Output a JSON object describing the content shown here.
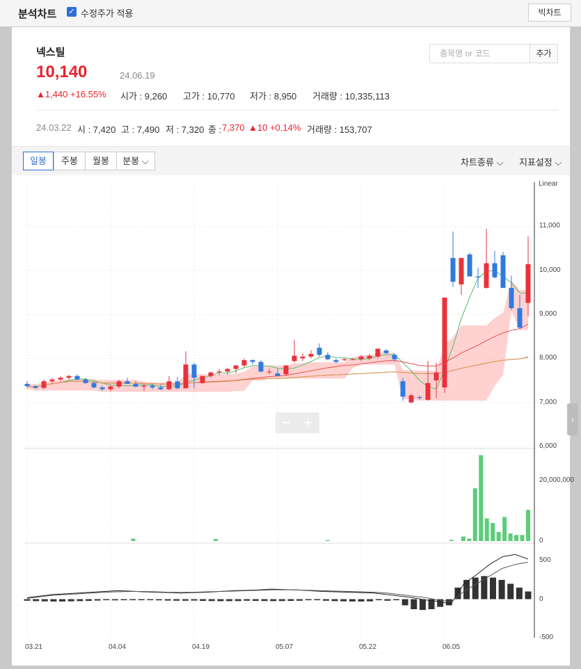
{
  "header": {
    "title": "분석차트",
    "adjusted_price_label": "수정주가 적용",
    "adjusted_price_checked": true,
    "big_chart_button": "빅차트"
  },
  "stock": {
    "name": "넥스틸",
    "price": "10,140",
    "date": "24.06.19",
    "change": "▲1,440 +16.55%",
    "open": "시가 : 9,260",
    "high": "고가 : 10,770",
    "low": "저가 : 8,950",
    "volume": "거래량 : 10,335,113"
  },
  "search": {
    "placeholder": "종목명 or 코드",
    "add_button": "추가"
  },
  "prev_day": {
    "date": "24.03.22",
    "open": "시 : 7,420",
    "high": "고 : 7,490",
    "low": "저 : 7,320",
    "close_label": "종 :",
    "close_value": "7,370",
    "change": "▲10 +0.14%",
    "volume": "거래량 : 153,707"
  },
  "toolbar": {
    "tabs": [
      "일봉",
      "주봉",
      "월봉",
      "분봉"
    ],
    "active_tab": "일봉",
    "chart_type": "차트종류",
    "indicator_settings": "지표설정"
  },
  "colors": {
    "up": "#e8323c",
    "down": "#2f7ae0",
    "volume": "#5dcc7a",
    "cloud": "#ff7b7b"
  },
  "chart_data": {
    "type": "candlestick",
    "scale_label": "Linear",
    "price_axis": {
      "ticks": [
        6000,
        7000,
        8000,
        9000,
        10000,
        11000
      ],
      "labels": [
        "6,000",
        "7,000",
        "8,000",
        "9,000",
        "10,000",
        "11,000"
      ],
      "ylim": [
        6000,
        12000
      ]
    },
    "volume_axis": {
      "ticks": [
        0,
        20000000
      ],
      "labels": [
        "0",
        "20,000,000"
      ],
      "ylim": [
        0,
        30000000
      ]
    },
    "macd_axis": {
      "ticks": [
        -500,
        0,
        500
      ],
      "labels": [
        "-500",
        "0",
        "500"
      ],
      "ylim": [
        -500,
        700
      ]
    },
    "x_labels": [
      "03.21",
      "04.04",
      "04.19",
      "05.07",
      "05.22",
      "06.05"
    ],
    "x_label_index": [
      0,
      10,
      20,
      30,
      40,
      50
    ],
    "candles": [
      [
        7420,
        7490,
        7320,
        7370
      ],
      [
        7370,
        7400,
        7300,
        7330
      ],
      [
        7330,
        7520,
        7300,
        7480
      ],
      [
        7480,
        7560,
        7440,
        7520
      ],
      [
        7520,
        7600,
        7480,
        7560
      ],
      [
        7560,
        7620,
        7520,
        7600
      ],
      [
        7600,
        7640,
        7500,
        7520
      ],
      [
        7520,
        7560,
        7420,
        7440
      ],
      [
        7440,
        7480,
        7320,
        7340
      ],
      [
        7340,
        7380,
        7260,
        7300
      ],
      [
        7300,
        7400,
        7260,
        7360
      ],
      [
        7360,
        7520,
        7320,
        7480
      ],
      [
        7480,
        7560,
        7420,
        7420
      ],
      [
        7420,
        7480,
        7340,
        7360
      ],
      [
        7360,
        7420,
        7260,
        7380
      ],
      [
        7380,
        7420,
        7300,
        7340
      ],
      [
        7340,
        7400,
        7280,
        7300
      ],
      [
        7300,
        7600,
        7280,
        7480
      ],
      [
        7480,
        7580,
        7300,
        7320
      ],
      [
        7320,
        8160,
        7320,
        7860
      ],
      [
        7860,
        7900,
        7320,
        7560
      ],
      [
        7440,
        7600,
        7420,
        7600
      ],
      [
        7600,
        7700,
        7560,
        7680
      ],
      [
        7680,
        7760,
        7620,
        7700
      ],
      [
        7700,
        7780,
        7640,
        7760
      ],
      [
        7760,
        7820,
        7660,
        7840
      ],
      [
        7840,
        8000,
        7800,
        7960
      ],
      [
        7960,
        7980,
        7860,
        7920
      ],
      [
        7920,
        7960,
        7680,
        7700
      ],
      [
        7700,
        7760,
        7640,
        7700
      ],
      [
        7660,
        7760,
        7600,
        7600
      ],
      [
        7640,
        7840,
        7600,
        7840
      ],
      [
        7940,
        8420,
        7900,
        8060
      ],
      [
        8000,
        8120,
        7940,
        8040
      ],
      [
        8040,
        8180,
        8000,
        8100
      ],
      [
        8240,
        8340,
        8040,
        8080
      ],
      [
        8080,
        8140,
        7960,
        7980
      ],
      [
        7960,
        8000,
        7900,
        7920
      ],
      [
        7960,
        8000,
        7940,
        7980
      ],
      [
        7980,
        8000,
        7960,
        7980
      ],
      [
        7980,
        8080,
        7940,
        8040
      ],
      [
        8000,
        8100,
        7960,
        8060
      ],
      [
        8040,
        8220,
        8000,
        8220
      ],
      [
        8180,
        8200,
        8100,
        8120
      ],
      [
        8080,
        8120,
        7920,
        7980
      ],
      [
        7480,
        7560,
        7040,
        7130
      ],
      [
        7000,
        7200,
        6980,
        7160
      ],
      [
        7120,
        7160,
        7060,
        7100
      ],
      [
        7060,
        7940,
        7040,
        7440
      ],
      [
        7500,
        7900,
        7100,
        7680
      ],
      [
        7340,
        9380,
        7220,
        9380
      ],
      [
        10280,
        10880,
        9620,
        9740
      ],
      [
        9680,
        10280,
        9440,
        10280
      ],
      [
        10360,
        10400,
        9880,
        9860
      ],
      [
        9860,
        10060,
        9600,
        9840
      ],
      [
        9600,
        10940,
        9580,
        10160
      ],
      [
        10160,
        10440,
        9820,
        9840
      ],
      [
        10340,
        10420,
        9760,
        9600
      ],
      [
        9600,
        9880,
        9100,
        9140
      ],
      [
        9140,
        9440,
        8660,
        8700
      ],
      [
        9260,
        10770,
        8950,
        10140
      ]
    ],
    "volume": [
      0,
      0,
      0,
      0,
      0,
      0,
      0,
      0,
      0,
      0,
      0,
      0,
      0,
      0,
      0,
      0,
      0,
      0,
      800000,
      0,
      0,
      0,
      0,
      0,
      0,
      0,
      0,
      0,
      0,
      0,
      0,
      0,
      700000,
      0,
      0,
      0,
      0,
      0,
      0,
      0,
      0,
      0,
      0,
      0,
      0,
      0,
      0,
      0,
      0,
      0,
      0,
      300000,
      0,
      0,
      0,
      0,
      0,
      0,
      0,
      0,
      0,
      0,
      0,
      0,
      0,
      0,
      0,
      0,
      0,
      0,
      0,
      0,
      400000,
      0,
      1500000,
      800000,
      17500000,
      28500000,
      7500000,
      6000000,
      3000000,
      8000000,
      2500000,
      2000000,
      2000000,
      10335113
    ],
    "macd_hist": [
      -20,
      -25,
      -28,
      -30,
      -30,
      -28,
      -25,
      -22,
      -18,
      0,
      -15,
      -12,
      -10,
      -8,
      -12,
      -15,
      -18,
      -20,
      -20,
      -18,
      -22,
      -24,
      -26,
      -25,
      -24,
      -20,
      -22,
      -24,
      -25,
      -24,
      -22,
      -20,
      -10,
      -8,
      -20,
      -25,
      -28,
      -30,
      -30,
      -28,
      0,
      -20,
      -10,
      -80,
      -130,
      -140,
      -130,
      -100,
      -80,
      150,
      250,
      280,
      300,
      280,
      250,
      200,
      150,
      100
    ],
    "macd_line": [
      20,
      40,
      60,
      70,
      80,
      90,
      100,
      110,
      105,
      95,
      90,
      85,
      80,
      85,
      90,
      100,
      110,
      115,
      120,
      130,
      125,
      120,
      110,
      100,
      95,
      90,
      85,
      80,
      60,
      40,
      20,
      -10,
      -30,
      -60,
      200,
      320,
      450,
      550,
      580,
      520
    ],
    "signal_line": [
      10,
      30,
      50,
      60,
      70,
      80,
      90,
      95,
      100,
      100,
      95,
      90,
      88,
      90,
      95,
      100,
      105,
      110,
      115,
      120,
      122,
      120,
      115,
      110,
      105,
      100,
      95,
      90,
      80,
      60,
      40,
      20,
      -10,
      -30,
      100,
      200,
      300,
      400,
      450,
      480
    ]
  },
  "zoom": {
    "minus": "−",
    "plus": "+"
  },
  "side_handle": "‹"
}
